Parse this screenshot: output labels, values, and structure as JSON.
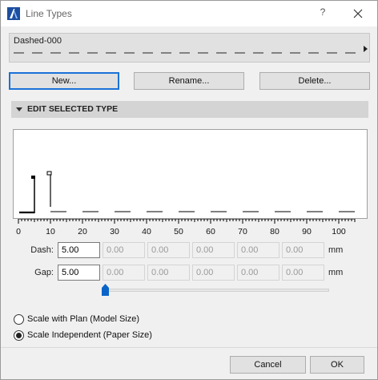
{
  "window": {
    "title": "Line Types",
    "help_label": "?",
    "close_label": "✕"
  },
  "preview": {
    "name": "Dashed-000"
  },
  "buttons": {
    "new": "New...",
    "rename": "Rename...",
    "delete": "Delete..."
  },
  "section": {
    "title": "EDIT SELECTED TYPE"
  },
  "ruler": {
    "ticks": [
      "0",
      "10",
      "20",
      "30",
      "40",
      "50",
      "60",
      "70",
      "80",
      "90",
      "100"
    ]
  },
  "dash": {
    "label": "Dash:",
    "values": [
      "5.00",
      "0.00",
      "0.00",
      "0.00",
      "0.00",
      "0.00"
    ],
    "unit": "mm"
  },
  "gap": {
    "label": "Gap:",
    "values": [
      "5.00",
      "0.00",
      "0.00",
      "0.00",
      "0.00",
      "0.00"
    ],
    "unit": "mm"
  },
  "scale": {
    "options": [
      {
        "label": "Scale with Plan (Model Size)",
        "checked": false
      },
      {
        "label": "Scale Independent (Paper Size)",
        "checked": true
      }
    ]
  },
  "footer": {
    "cancel": "Cancel",
    "ok": "OK"
  },
  "colors": {
    "accent": "#1a72d8",
    "slider_thumb": "#0a64c8"
  }
}
